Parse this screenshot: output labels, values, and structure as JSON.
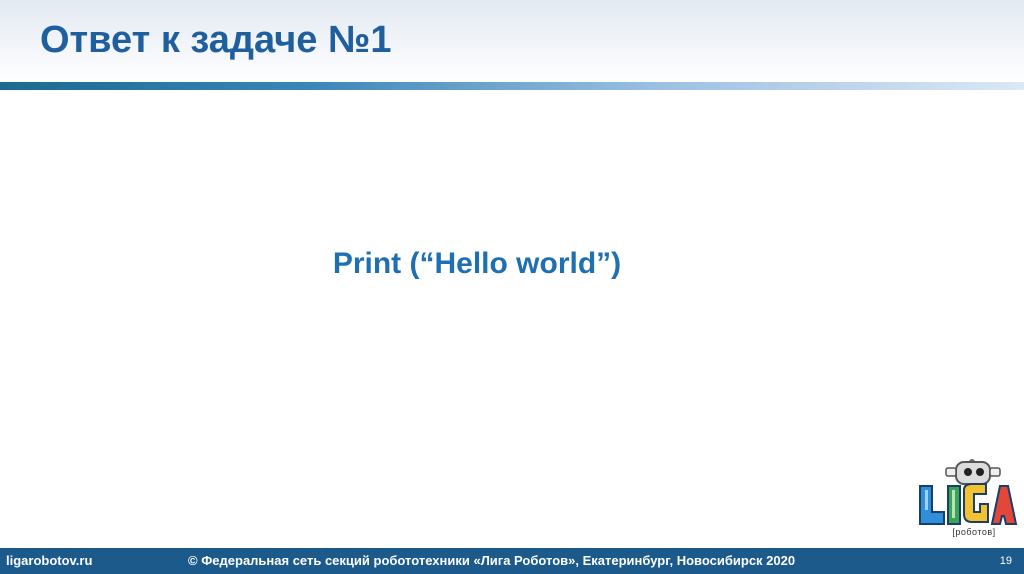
{
  "slide": {
    "title": "Ответ к задаче №1",
    "body": "Print (“Hello world”)"
  },
  "logo": {
    "name": "liga-robotov-logo",
    "text": "LIGA",
    "caption": "[роботов]"
  },
  "footer": {
    "site": "ligarobotov.ru",
    "copyright": "©  Федеральная сеть секций робототехники «Лига  Роботов», Екатеринбург, Новосибирск 2020",
    "page_number": "19"
  },
  "colors": {
    "title": "#1f5f9e",
    "body_text": "#1f6fb3",
    "footer_bg": "#1d5a8c",
    "accent_bar": "#3a86b8"
  }
}
